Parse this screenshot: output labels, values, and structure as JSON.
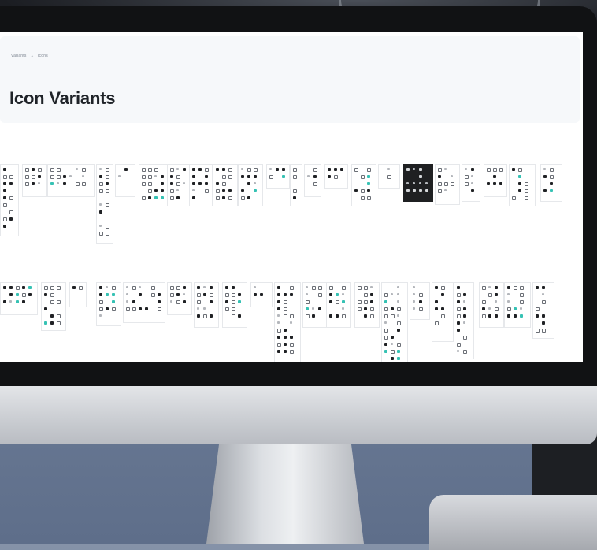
{
  "browser": {},
  "page": {
    "breadcrumb": [
      "Variants",
      "Icons"
    ],
    "breadcrumb_separator": "→",
    "title": "Icon Variants"
  },
  "theme": {
    "accent": "#36c2b4",
    "text": "#1f2328",
    "header_bg": "#f6f8fa",
    "card_border": "#e6e8eb",
    "dark_card": "#1f2022"
  },
  "icon_grid": {
    "rows": 3,
    "icon_variants": [
      "outline",
      "filled",
      "accent-filled"
    ]
  }
}
